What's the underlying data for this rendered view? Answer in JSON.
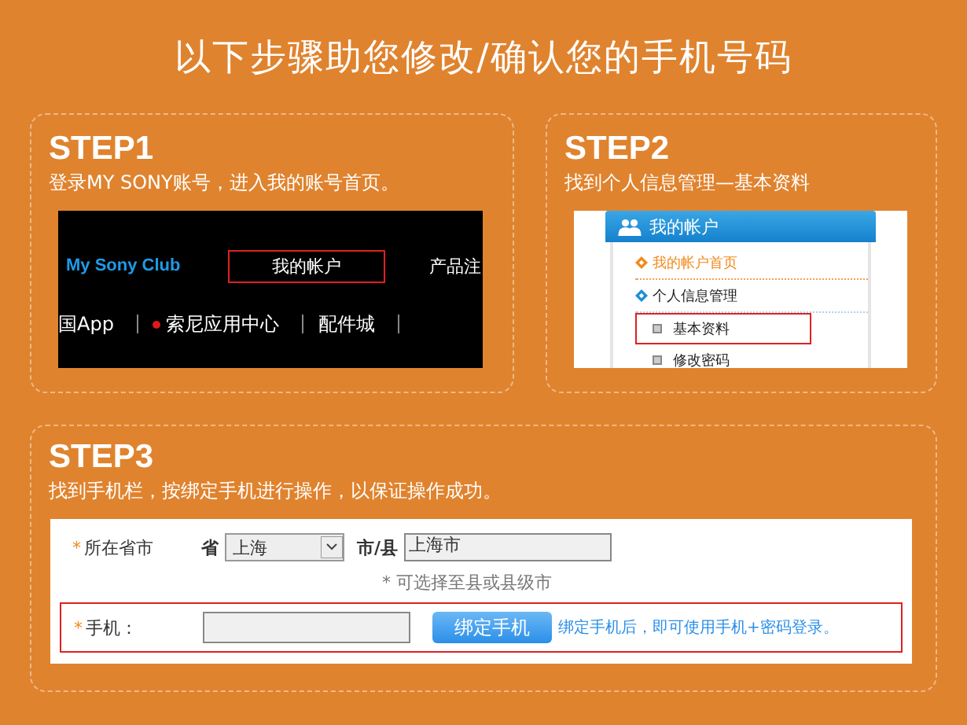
{
  "title": "以下步骤助您修改/确认您的手机号码",
  "step1": {
    "heading": "STEP1",
    "description": "登录MY SONY账号，进入我的账号首页。",
    "screenshot": {
      "brand": "My Sony Club",
      "nav_top": [
        {
          "label": "我的帐户",
          "highlighted": true
        },
        {
          "label": "产品注",
          "highlighted": false
        }
      ],
      "nav_bottom": [
        {
          "label": "国App",
          "dot": false
        },
        {
          "label": "索尼应用中心",
          "dot": true
        },
        {
          "label": "配件城",
          "dot": false
        }
      ]
    }
  },
  "step2": {
    "heading": "STEP2",
    "description": "找到个人信息管理—基本资料",
    "screenshot": {
      "header": "我的帐户",
      "items": [
        {
          "label": "我的帐户首页",
          "kind": "home"
        },
        {
          "label": "个人信息管理",
          "kind": "section",
          "children": [
            {
              "label": "基本资料",
              "highlighted": true
            },
            {
              "label": "修改密码",
              "highlighted": false
            }
          ]
        }
      ]
    }
  },
  "step3": {
    "heading": "STEP3",
    "description": "找到手机栏，按绑定手机进行操作，以保证操作成功。",
    "form": {
      "region_mark": "*",
      "region_label": "所在省市",
      "province_label": "省",
      "province_value": "上海",
      "city_label": "市/县",
      "city_value": "上海市",
      "note": "* 可选择至县或县级市",
      "phone_mark": "*",
      "phone_label": "手机：",
      "phone_highlighted": true,
      "bind_button": "绑定手机",
      "bind_hint": "绑定手机后，即可使用手机+密码登录。"
    }
  }
}
